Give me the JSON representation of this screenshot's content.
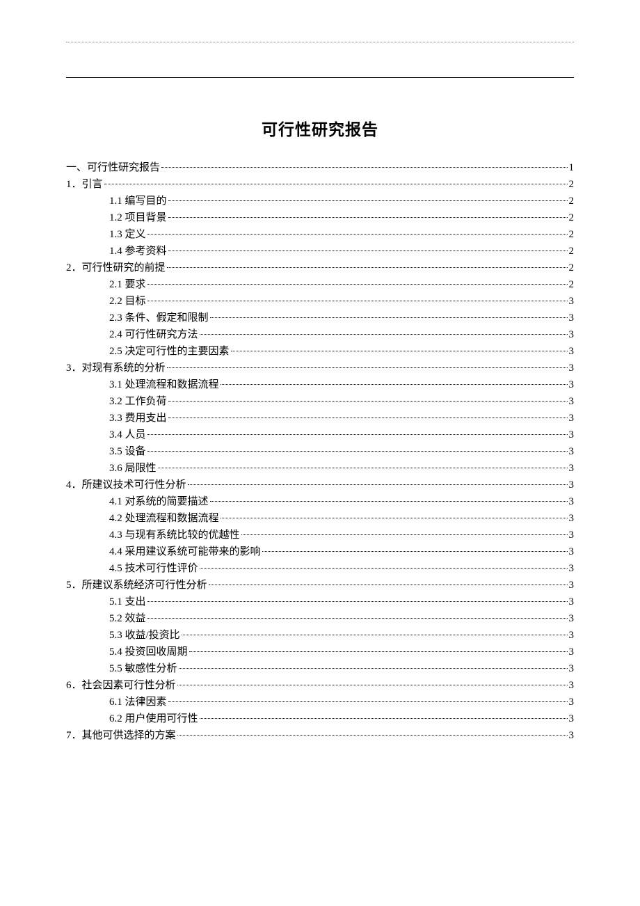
{
  "title": "可行性研究报告",
  "toc": [
    {
      "level": 0,
      "label": "一、可行性研究报告",
      "page": "1"
    },
    {
      "level": 1,
      "label": "1．引言",
      "page": "2"
    },
    {
      "level": 2,
      "label": "1.1 编写目的",
      "page": "2"
    },
    {
      "level": 2,
      "label": "1.2 项目背景",
      "page": "2"
    },
    {
      "level": 2,
      "label": "1.3 定义",
      "page": "2"
    },
    {
      "level": 2,
      "label": "1.4 参考资料",
      "page": "2"
    },
    {
      "level": 1,
      "label": "2．可行性研究的前提",
      "page": "2"
    },
    {
      "level": 2,
      "label": "2.1 要求",
      "page": "2"
    },
    {
      "level": 2,
      "label": "2.2 目标",
      "page": "3"
    },
    {
      "level": 2,
      "label": "2.3 条件、假定和限制",
      "page": "3"
    },
    {
      "level": 2,
      "label": "2.4 可行性研究方法",
      "page": "3"
    },
    {
      "level": 2,
      "label": "2.5 决定可行性的主要因素",
      "page": "3"
    },
    {
      "level": 1,
      "label": "3．对现有系统的分析",
      "page": "3"
    },
    {
      "level": 2,
      "label": "3.1 处理流程和数据流程",
      "page": "3"
    },
    {
      "level": 2,
      "label": "3.2 工作负荷",
      "page": "3"
    },
    {
      "level": 2,
      "label": "3.3 费用支出",
      "page": "3"
    },
    {
      "level": 2,
      "label": "3.4 人员",
      "page": "3"
    },
    {
      "level": 2,
      "label": "3.5 设备",
      "page": "3"
    },
    {
      "level": 2,
      "label": "3.6 局限性",
      "page": "3"
    },
    {
      "level": 1,
      "label": "4．所建议技术可行性分析",
      "page": "3"
    },
    {
      "level": 2,
      "label": "4.1 对系统的简要描述",
      "page": "3"
    },
    {
      "level": 2,
      "label": "4.2 处理流程和数据流程",
      "page": "3"
    },
    {
      "level": 2,
      "label": "4.3 与现有系统比较的优越性",
      "page": "3"
    },
    {
      "level": 2,
      "label": "4.4 采用建议系统可能带来的影响",
      "page": "3"
    },
    {
      "level": 2,
      "label": "4.5 技术可行性评价",
      "page": "3"
    },
    {
      "level": 1,
      "label": "5．所建议系统经济可行性分析",
      "page": "3"
    },
    {
      "level": 2,
      "label": "5.1 支出",
      "page": "3"
    },
    {
      "level": 2,
      "label": "5.2 效益",
      "page": "3"
    },
    {
      "level": 2,
      "label": "5.3 收益/投资比",
      "page": "3"
    },
    {
      "level": 2,
      "label": "5.4 投资回收周期",
      "page": "3"
    },
    {
      "level": 2,
      "label": "5.5 敏感性分析",
      "page": "3"
    },
    {
      "level": 1,
      "label": "6．社会因素可行性分析",
      "page": "3"
    },
    {
      "level": 2,
      "label": "6.1 法律因素",
      "page": "3"
    },
    {
      "level": 2,
      "label": "6.2 用户使用可行性",
      "page": "3"
    },
    {
      "level": 1,
      "label": "7．其他可供选择的方案",
      "page": "3"
    }
  ]
}
